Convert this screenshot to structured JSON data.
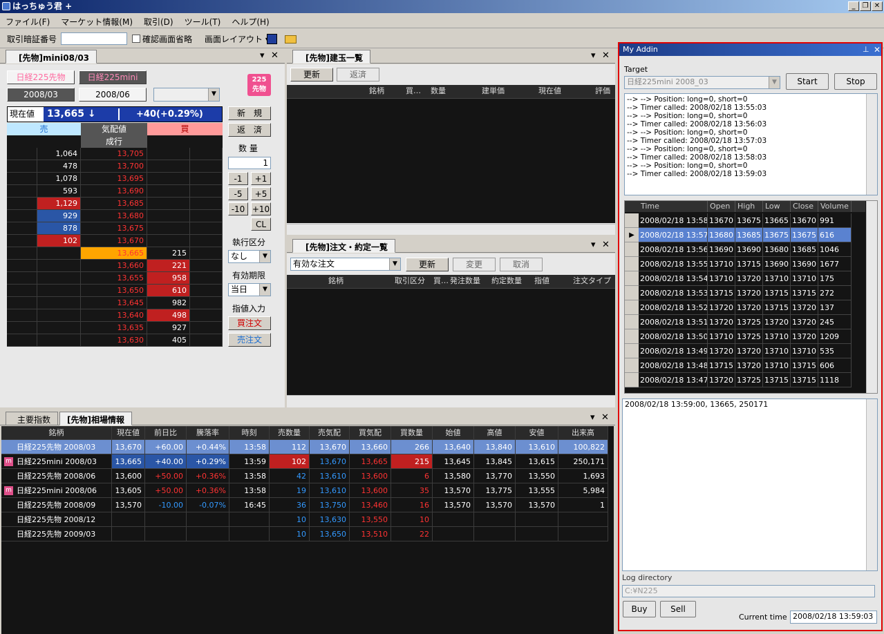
{
  "window": {
    "title": "はっちゅう君 +",
    "minimize": "_",
    "restore": "❐",
    "close": "✕"
  },
  "menu": [
    "ファイル(F)",
    "マーケット情報(M)",
    "取引(D)",
    "ツール(T)",
    "ヘルプ(H)"
  ],
  "toolbar": {
    "pin_label": "取引暗証番号",
    "skip_confirm": "確認画面省略",
    "layout": "画面レイアウト ▾"
  },
  "futures_panel": {
    "tab": "[先物]mini08/03",
    "btn_nikkei225": "日経225先物",
    "btn_nikkei225mini": "日経225mini",
    "month1": "2008/03",
    "month2": "2008/06",
    "logo_line1": "225",
    "logo_line2": "先物",
    "current_label": "現在値",
    "current_price": "13,665 ↓",
    "change": "+40(+0.29%)",
    "col_sell": "売",
    "col_quote": "気配値",
    "col_buy": "買",
    "market_order": "成行",
    "book": [
      {
        "sell": "1,064",
        "price": "13,705",
        "buy": ""
      },
      {
        "sell": "478",
        "price": "13,700",
        "buy": ""
      },
      {
        "sell": "1,078",
        "price": "13,695",
        "buy": ""
      },
      {
        "sell": "593",
        "price": "13,690",
        "buy": ""
      },
      {
        "sell": "1,129",
        "price": "13,685",
        "buy": ""
      },
      {
        "sell": "929",
        "price": "13,680",
        "buy": ""
      },
      {
        "sell": "878",
        "price": "13,675",
        "buy": ""
      },
      {
        "sell": "102",
        "price": "13,670",
        "buy": ""
      },
      {
        "sell": "",
        "price": "13,665",
        "buy": "215"
      },
      {
        "sell": "",
        "price": "13,660",
        "buy": "221"
      },
      {
        "sell": "",
        "price": "13,655",
        "buy": "958"
      },
      {
        "sell": "",
        "price": "13,650",
        "buy": "610"
      },
      {
        "sell": "",
        "price": "13,645",
        "buy": "982"
      },
      {
        "sell": "",
        "price": "13,640",
        "buy": "498"
      },
      {
        "sell": "",
        "price": "13,635",
        "buy": "927"
      },
      {
        "sell": "",
        "price": "13,630",
        "buy": "405"
      }
    ],
    "btn_new": "新　規",
    "btn_close": "返　済",
    "qty_label": "数 量",
    "qty_value": "1",
    "qty_buttons": [
      "-1",
      "+1",
      "-5",
      "+5",
      "-10",
      "+10"
    ],
    "btn_cl": "CL",
    "exec_label": "執行区分",
    "exec_value": "なし",
    "expiry_label": "有効期限",
    "expiry_value": "当日",
    "limit_label": "指値入力",
    "btn_buy_order": "買注文",
    "btn_sell_order": "売注文"
  },
  "positions_panel": {
    "tab": "[先物]建玉一覧",
    "btn_refresh": "更新",
    "btn_repay": "返済",
    "columns": [
      "銘柄",
      "買…",
      "数量",
      "建単価",
      "現在値",
      "評価"
    ]
  },
  "orders_panel": {
    "tab": "[先物]注文・約定一覧",
    "filter": "有効な注文",
    "btn_refresh": "更新",
    "btn_change": "変更",
    "btn_cancel": "取消",
    "columns": [
      "銘柄",
      "取引区分",
      "買…",
      "発注数量",
      "約定数量",
      "指値",
      "注文タイプ"
    ]
  },
  "market_panel": {
    "tab_index": "主要指数",
    "tab_market": "[先物]相場情報",
    "columns": [
      "銘柄",
      "現在値",
      "前日比",
      "騰落率",
      "時刻",
      "売数量",
      "売気配",
      "買気配",
      "買数量",
      "始値",
      "高値",
      "安値",
      "出来高"
    ],
    "rows": [
      {
        "mark": "",
        "name": "日経225先物 2008/03",
        "price": "13,670",
        "chg": "+60.00",
        "pct": "+0.44%",
        "time": "13:58",
        "askq": "112",
        "ask": "13,670",
        "bid": "13,660",
        "bidq": "266",
        "open": "13,640",
        "high": "13,840",
        "low": "13,610",
        "vol": "100,822"
      },
      {
        "mark": "m",
        "name": "日経225mini 2008/03",
        "price": "13,665",
        "chg": "+40.00",
        "pct": "+0.29%",
        "time": "13:59",
        "askq": "102",
        "ask": "13,670",
        "bid": "13,665",
        "bidq": "215",
        "open": "13,645",
        "high": "13,845",
        "low": "13,615",
        "vol": "250,171"
      },
      {
        "mark": "",
        "name": "日経225先物 2008/06",
        "price": "13,600",
        "chg": "+50.00",
        "pct": "+0.36%",
        "time": "13:58",
        "askq": "42",
        "ask": "13,610",
        "bid": "13,600",
        "bidq": "6",
        "open": "13,580",
        "high": "13,770",
        "low": "13,550",
        "vol": "1,693"
      },
      {
        "mark": "m",
        "name": "日経225mini 2008/06",
        "price": "13,605",
        "chg": "+50.00",
        "pct": "+0.36%",
        "time": "13:58",
        "askq": "19",
        "ask": "13,610",
        "bid": "13,600",
        "bidq": "35",
        "open": "13,570",
        "high": "13,775",
        "low": "13,555",
        "vol": "5,984"
      },
      {
        "mark": "",
        "name": "日経225先物 2008/09",
        "price": "13,570",
        "chg": "-10.00",
        "pct": "-0.07%",
        "time": "16:45",
        "askq": "36",
        "ask": "13,750",
        "bid": "13,460",
        "bidq": "16",
        "open": "13,570",
        "high": "13,570",
        "low": "13,570",
        "vol": "1"
      },
      {
        "mark": "",
        "name": "日経225先物 2008/12",
        "price": "",
        "chg": "",
        "pct": "",
        "time": "",
        "askq": "10",
        "ask": "13,630",
        "bid": "13,550",
        "bidq": "10",
        "open": "",
        "high": "",
        "low": "",
        "vol": ""
      },
      {
        "mark": "",
        "name": "日経225先物 2009/03",
        "price": "",
        "chg": "",
        "pct": "",
        "time": "",
        "askq": "10",
        "ask": "13,650",
        "bid": "13,510",
        "bidq": "22",
        "open": "",
        "high": "",
        "low": "",
        "vol": ""
      }
    ]
  },
  "addin": {
    "title": "My Addin",
    "pin": "⊥",
    "close": "✕",
    "target_label": "Target",
    "target_value": "日経225mini 2008_03",
    "btn_start": "Start",
    "btn_stop": "Stop",
    "log_lines": [
      "--> --> Position: long=0, short=0",
      "--> Timer called: 2008/02/18 13:55:03",
      "--> --> Position: long=0, short=0",
      "--> Timer called: 2008/02/18 13:56:03",
      "--> --> Position: long=0, short=0",
      "--> Timer called: 2008/02/18 13:57:03",
      "--> --> Position: long=0, short=0",
      "--> Timer called: 2008/02/18 13:58:03",
      "--> --> Position: long=0, short=0",
      "--> Timer called: 2008/02/18 13:59:03"
    ],
    "ohlc_columns": [
      "Time",
      "Open",
      "High",
      "Low",
      "Close",
      "Volume"
    ],
    "ohlc_rows": [
      [
        "2008/02/18 13:58",
        "13670",
        "13675",
        "13665",
        "13670",
        "991"
      ],
      [
        "2008/02/18 13:57",
        "13680",
        "13685",
        "13675",
        "13675",
        "616"
      ],
      [
        "2008/02/18 13:56",
        "13690",
        "13690",
        "13680",
        "13685",
        "1046"
      ],
      [
        "2008/02/18 13:55",
        "13710",
        "13715",
        "13690",
        "13690",
        "1677"
      ],
      [
        "2008/02/18 13:54",
        "13710",
        "13720",
        "13710",
        "13710",
        "175"
      ],
      [
        "2008/02/18 13:53",
        "13715",
        "13720",
        "13715",
        "13715",
        "272"
      ],
      [
        "2008/02/18 13:52",
        "13720",
        "13720",
        "13715",
        "13720",
        "137"
      ],
      [
        "2008/02/18 13:51",
        "13720",
        "13725",
        "13720",
        "13720",
        "245"
      ],
      [
        "2008/02/18 13:50",
        "13710",
        "13725",
        "13710",
        "13720",
        "1209"
      ],
      [
        "2008/02/18 13:49",
        "13720",
        "13720",
        "13710",
        "13710",
        "535"
      ],
      [
        "2008/02/18 13:48",
        "13715",
        "13720",
        "13710",
        "13715",
        "606"
      ],
      [
        "2008/02/18 13:47",
        "13720",
        "13725",
        "13715",
        "13715",
        "1118"
      ]
    ],
    "output_text": "2008/02/18 13:59:00, 13665, 250171",
    "logdir_label": "Log directory",
    "logdir_value": "C:¥N225",
    "btn_buy": "Buy",
    "btn_sell": "Sell",
    "current_time_label": "Current time",
    "current_time_value": "2008/02/18 13:59:03"
  },
  "colors": {
    "accent_blue": "#2a56a6",
    "ask_red": "#c02020",
    "text_red": "#ff3333",
    "text_blue": "#3399ff",
    "addin_border": "#e00000"
  }
}
